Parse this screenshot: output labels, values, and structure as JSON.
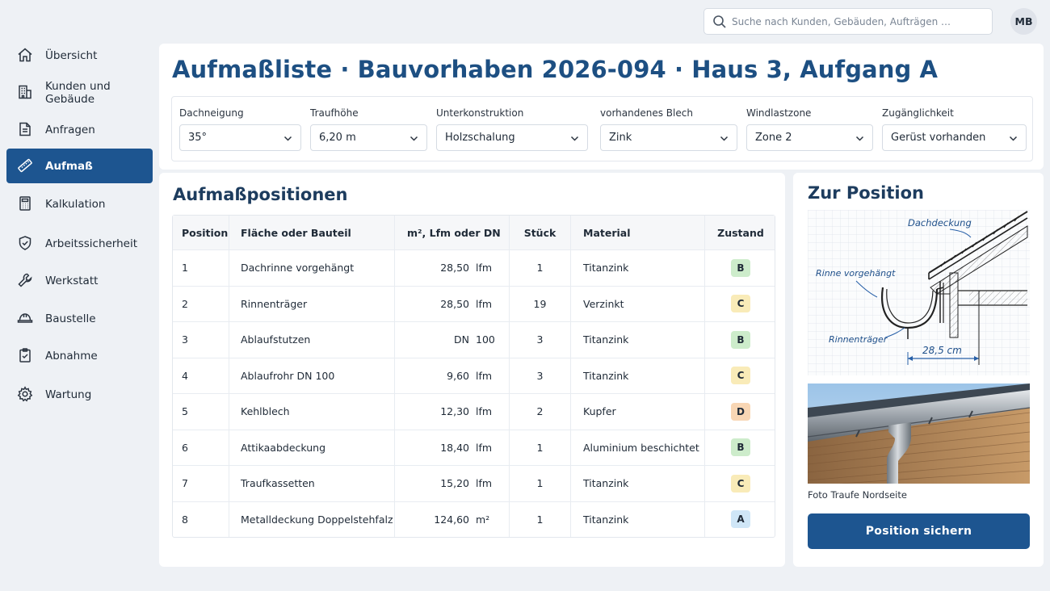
{
  "sidebar": {
    "items": [
      {
        "label": "Übersicht",
        "icon": "home-icon"
      },
      {
        "label": "Kunden und Gebäude",
        "icon": "building-icon"
      },
      {
        "label": "Anfragen",
        "icon": "document-icon"
      },
      {
        "label": "Aufmaß",
        "icon": "ruler-icon",
        "active": true
      },
      {
        "label": "Kalkulation",
        "icon": "calculator-icon"
      },
      {
        "label": "Arbeitssicherheit",
        "icon": "shield-check-icon"
      },
      {
        "label": "Werkstatt",
        "icon": "wrench-icon"
      },
      {
        "label": "Baustelle",
        "icon": "hard-hat-icon"
      },
      {
        "label": "Abnahme",
        "icon": "clipboard-check-icon"
      },
      {
        "label": "Wartung",
        "icon": "gear-icon"
      }
    ]
  },
  "search": {
    "placeholder": "Suche nach Kunden, Gebäuden, Aufträgen …"
  },
  "user": {
    "initials": "MB"
  },
  "header": {
    "title": "Aufmaßliste · Bauvorhaben 2026-094 · Haus 3, Aufgang A"
  },
  "filters": [
    {
      "label": "Dachneigung",
      "value": "35°"
    },
    {
      "label": "Traufhöhe",
      "value": "6,20 m"
    },
    {
      "label": "Unterkonstruktion",
      "value": "Holzschalung"
    },
    {
      "label": "vorhandenes Blech",
      "value": "Zink"
    },
    {
      "label": "Windlastzone",
      "value": "Zone 2"
    },
    {
      "label": "Zugänglichkeit",
      "value": "Gerüst vorhanden"
    }
  ],
  "positions": {
    "title": "Aufmaßpositionen",
    "columns": [
      "Position",
      "Fläche oder Bauteil",
      "m², Lfm oder DN",
      "Stück",
      "Material",
      "Zustand"
    ],
    "rows": [
      {
        "pos": "1",
        "part": "Dachrinne vorgehängt",
        "qty": "28,50",
        "unit": "lfm",
        "count": "1",
        "material": "Titanzink",
        "state": "B"
      },
      {
        "pos": "2",
        "part": "Rinnenträger",
        "qty": "28,50",
        "unit": "lfm",
        "count": "19",
        "material": "Verzinkt",
        "state": "C"
      },
      {
        "pos": "3",
        "part": "Ablaufstutzen",
        "qty": "DN",
        "unit": "100",
        "count": "3",
        "material": "Titanzink",
        "state": "B"
      },
      {
        "pos": "4",
        "part": "Ablaufrohr DN 100",
        "qty": "9,60",
        "unit": "lfm",
        "count": "3",
        "material": "Titanzink",
        "state": "C"
      },
      {
        "pos": "5",
        "part": "Kehlblech",
        "qty": "12,30",
        "unit": "lfm",
        "count": "2",
        "material": "Kupfer",
        "state": "D"
      },
      {
        "pos": "6",
        "part": "Attikaabdeckung",
        "qty": "18,40",
        "unit": "lfm",
        "count": "1",
        "material": "Aluminium beschichtet",
        "state": "B"
      },
      {
        "pos": "7",
        "part": "Traufkassetten",
        "qty": "15,20",
        "unit": "lfm",
        "count": "1",
        "material": "Titanzink",
        "state": "C"
      },
      {
        "pos": "8",
        "part": "Metalldeckung Doppelstehfalz",
        "qty": "124,60",
        "unit": "m²",
        "count": "1",
        "material": "Titanzink",
        "state": "A"
      }
    ]
  },
  "state_colors": {
    "A": "#cfe6f7",
    "B": "#cdeccb",
    "C": "#f9ebb8",
    "D": "#f8d6b4"
  },
  "detail": {
    "title": "Zur Position",
    "sketch_labels": {
      "roof": "Dachdeckung",
      "gutter": "Rinne vorgehängt",
      "bracket": "Rinnenträger",
      "dimension": "28,5 cm"
    },
    "caption": "Foto Traufe Nordseite",
    "button": "Position sichern"
  },
  "colors": {
    "accent": "#1d5590",
    "title": "#1d4f82"
  }
}
